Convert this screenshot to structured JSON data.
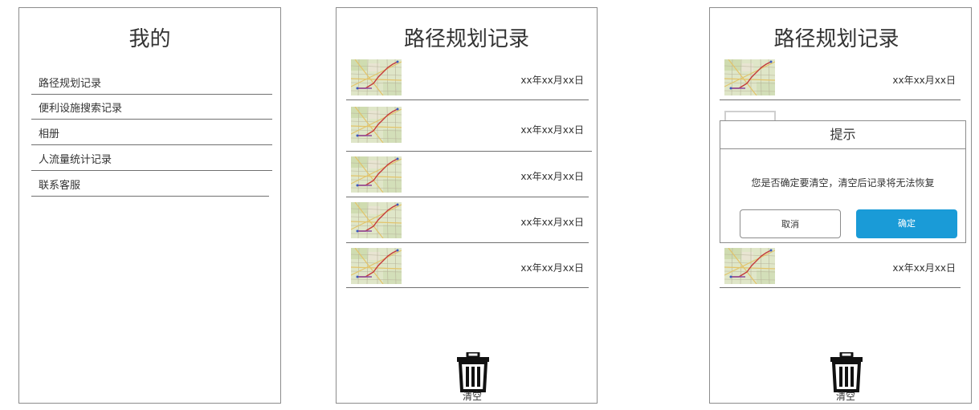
{
  "screens": {
    "profile": {
      "title": "我的",
      "menu": [
        {
          "label": "路径规划记录"
        },
        {
          "label": "便利设施搜索记录"
        },
        {
          "label": "相册"
        },
        {
          "label": "人流量统计记录"
        },
        {
          "label": "联系客服"
        }
      ]
    },
    "records": {
      "title": "路径规划记录",
      "items": [
        {
          "date": "xx年xx月xx日"
        },
        {
          "date": "xx年xx月xx日"
        },
        {
          "date": "xx年xx月xx日"
        },
        {
          "date": "xx年xx月xx日"
        },
        {
          "date": "xx年xx月xx日"
        }
      ],
      "clear_label": "清空"
    },
    "confirm": {
      "title": "路径规划记录",
      "items": [
        {
          "date": "xx年xx月xx日"
        },
        {
          "date": "xx年xx月xx日"
        }
      ],
      "dialog": {
        "title": "提示",
        "message": "您是否确定要清空，清空后记录将无法恢复",
        "cancel_label": "取消",
        "ok_label": "确定"
      },
      "clear_label": "清空"
    }
  },
  "colors": {
    "primary": "#1a9bd7",
    "border": "#8c8c8c",
    "text": "#333333"
  },
  "icons": {
    "trash": "trash-icon",
    "map_thumbnail": "map-thumbnail-icon",
    "image_placeholder": "image-placeholder-icon"
  }
}
